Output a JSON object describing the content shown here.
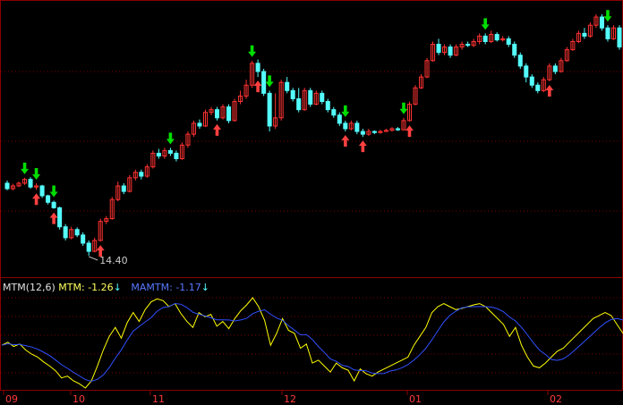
{
  "indicator": {
    "name": "MTM(12,6)",
    "mtm_label": "MTM:",
    "mtm_value": "-1.26",
    "mtm_arrow": "↓",
    "mamtm_label": "MAMTM:",
    "mamtm_value": "-1.17",
    "mamtm_arrow": "↓"
  },
  "colors": {
    "background": "#000000",
    "frame": "#8b0000",
    "up": "#ff3232",
    "down": "#54fcfc",
    "buy_arrow": "#ff4040",
    "sell_arrow": "#00dd00",
    "mtm_line": "#ffff00",
    "mamtm_line": "#3050ff",
    "axis_text": "#ff3a3a",
    "label_text": "#dddddd"
  },
  "chart_data": {
    "type": "candlestick",
    "x_ticks": [
      "09",
      "10",
      "11",
      "12",
      "01",
      "02"
    ],
    "low_label": "14.40",
    "candles": [
      [
        37.5,
        36.5,
        38.0,
        36.2
      ],
      [
        36.5,
        37.0,
        37.4,
        36.2
      ],
      [
        37.0,
        37.5,
        37.8,
        36.8
      ],
      [
        37.5,
        38.2,
        38.5,
        37.2
      ],
      [
        38.2,
        36.8,
        38.6,
        36.5
      ],
      [
        36.8,
        37.0,
        37.5,
        36.3
      ],
      [
        37.0,
        35.2,
        37.2,
        34.8
      ],
      [
        35.2,
        34.0,
        35.4,
        33.6
      ],
      [
        34.0,
        33.0,
        34.3,
        32.8
      ],
      [
        33.0,
        29.5,
        33.2,
        29.0
      ],
      [
        29.5,
        27.5,
        30.0,
        27.0
      ],
      [
        27.5,
        29.0,
        29.5,
        27.2
      ],
      [
        29.0,
        28.0,
        29.4,
        27.6
      ],
      [
        28.0,
        26.5,
        28.5,
        26.0
      ],
      [
        26.5,
        25.0,
        27.0,
        24.2
      ],
      [
        25.0,
        27.0,
        27.5,
        24.8
      ],
      [
        27.0,
        30.5,
        31.0,
        26.8
      ],
      [
        30.5,
        31.0,
        31.5,
        30.0
      ],
      [
        31.0,
        34.5,
        35.0,
        30.8
      ],
      [
        34.5,
        37.0,
        37.8,
        34.2
      ],
      [
        37.0,
        36.0,
        37.5,
        35.5
      ],
      [
        36.0,
        38.5,
        39.0,
        35.8
      ],
      [
        38.5,
        39.5,
        40.0,
        38.0
      ],
      [
        39.5,
        38.8,
        40.0,
        38.2
      ],
      [
        38.8,
        40.5,
        41.0,
        38.5
      ],
      [
        40.5,
        43.0,
        43.5,
        40.2
      ],
      [
        43.0,
        42.5,
        43.8,
        42.0
      ],
      [
        42.5,
        43.5,
        44.0,
        42.0
      ],
      [
        43.5,
        43.0,
        44.0,
        42.5
      ],
      [
        43.0,
        42.0,
        43.5,
        41.5
      ],
      [
        42.0,
        44.5,
        45.0,
        41.8
      ],
      [
        44.5,
        46.5,
        47.0,
        44.0
      ],
      [
        46.5,
        48.5,
        49.0,
        46.0
      ],
      [
        48.5,
        48.0,
        49.2,
        47.5
      ],
      [
        48.0,
        50.5,
        51.0,
        47.8
      ],
      [
        50.5,
        51.0,
        51.5,
        50.0
      ],
      [
        51.0,
        49.5,
        51.5,
        49.0
      ],
      [
        49.5,
        51.5,
        52.0,
        49.2
      ],
      [
        51.5,
        49.0,
        52.0,
        48.5
      ],
      [
        49.0,
        52.5,
        53.0,
        48.8
      ],
      [
        52.5,
        53.5,
        54.5,
        52.0
      ],
      [
        53.5,
        55.5,
        56.5,
        53.0
      ],
      [
        55.5,
        59.5,
        60.0,
        55.0
      ],
      [
        59.5,
        58.0,
        60.2,
        57.0
      ],
      [
        58.0,
        54.0,
        58.5,
        53.5
      ],
      [
        54.0,
        48.0,
        54.5,
        47.0
      ],
      [
        48.0,
        49.5,
        54.0,
        47.5
      ],
      [
        49.5,
        56.0,
        56.5,
        49.0
      ],
      [
        56.0,
        54.5,
        57.0,
        54.0
      ],
      [
        54.5,
        53.0,
        55.0,
        52.5
      ],
      [
        53.0,
        51.0,
        55.0,
        50.5
      ],
      [
        51.0,
        54.5,
        55.0,
        50.8
      ],
      [
        54.5,
        52.0,
        55.0,
        51.5
      ],
      [
        52.0,
        54.0,
        54.5,
        51.8
      ],
      [
        54.0,
        52.5,
        54.5,
        52.0
      ],
      [
        52.5,
        51.0,
        53.0,
        50.5
      ],
      [
        51.0,
        50.0,
        51.5,
        49.5
      ],
      [
        50.0,
        48.5,
        50.5,
        48.0
      ],
      [
        48.5,
        47.5,
        49.0,
        47.0
      ],
      [
        47.5,
        48.5,
        49.0,
        47.2
      ],
      [
        48.5,
        47.0,
        49.0,
        46.5
      ],
      [
        47.0,
        46.5,
        47.5,
        46.0
      ],
      [
        46.5,
        47.0,
        47.5,
        46.2
      ],
      [
        47.0,
        46.8,
        47.2,
        46.5
      ],
      [
        46.8,
        47.0,
        47.3,
        46.6
      ],
      [
        47.0,
        47.2,
        47.5,
        46.9
      ],
      [
        47.2,
        47.5,
        47.8,
        47.0
      ],
      [
        47.5,
        47.3,
        47.8,
        47.1
      ],
      [
        47.3,
        49.0,
        49.5,
        47.2
      ],
      [
        49.0,
        52.0,
        52.5,
        48.8
      ],
      [
        52.0,
        55.0,
        55.5,
        51.8
      ],
      [
        55.0,
        57.0,
        57.5,
        54.8
      ],
      [
        57.0,
        60.0,
        60.5,
        56.8
      ],
      [
        60.0,
        63.0,
        63.5,
        59.8
      ],
      [
        63.0,
        61.5,
        64.0,
        61.0
      ],
      [
        61.5,
        62.5,
        63.0,
        61.0
      ],
      [
        62.5,
        61.0,
        63.0,
        60.5
      ],
      [
        61.0,
        62.5,
        63.0,
        60.8
      ],
      [
        62.5,
        63.0,
        63.5,
        62.0
      ],
      [
        63.0,
        62.8,
        63.5,
        62.5
      ],
      [
        62.8,
        63.5,
        64.0,
        62.5
      ],
      [
        63.5,
        64.5,
        65.0,
        63.0
      ],
      [
        64.5,
        63.5,
        65.0,
        63.0
      ],
      [
        63.5,
        64.8,
        65.5,
        63.2
      ],
      [
        64.8,
        63.8,
        65.2,
        63.5
      ],
      [
        63.8,
        64.0,
        64.5,
        63.5
      ],
      [
        64.0,
        63.0,
        64.5,
        62.5
      ],
      [
        63.0,
        61.0,
        63.5,
        60.5
      ],
      [
        61.0,
        59.0,
        61.5,
        58.5
      ],
      [
        59.0,
        57.0,
        59.5,
        56.0
      ],
      [
        57.0,
        55.5,
        57.5,
        55.0
      ],
      [
        55.5,
        54.5,
        56.0,
        54.0
      ],
      [
        54.5,
        56.5,
        57.0,
        54.2
      ],
      [
        56.5,
        59.0,
        59.5,
        56.2
      ],
      [
        59.0,
        58.0,
        59.5,
        57.5
      ],
      [
        58.0,
        60.0,
        60.5,
        57.8
      ],
      [
        60.0,
        62.0,
        62.5,
        59.8
      ],
      [
        62.0,
        63.5,
        64.0,
        61.8
      ],
      [
        63.5,
        65.0,
        65.5,
        63.2
      ],
      [
        65.0,
        64.5,
        66.0,
        64.0
      ],
      [
        64.5,
        66.5,
        67.0,
        64.2
      ],
      [
        66.5,
        68.0,
        68.5,
        66.0
      ],
      [
        68.0,
        66.0,
        68.5,
        65.5
      ],
      [
        66.0,
        64.0,
        66.5,
        63.5
      ],
      [
        64.0,
        66.0,
        66.5,
        63.8
      ],
      [
        66.0,
        62.5,
        66.5,
        62.0
      ]
    ],
    "buy_signals": [
      5,
      8,
      16,
      36,
      43,
      58,
      61,
      69,
      93
    ],
    "sell_signals": [
      3,
      5,
      8,
      28,
      42,
      45,
      58,
      68,
      82,
      103
    ],
    "mtm": [
      1.0,
      1.5,
      0.8,
      1.2,
      0.2,
      -0.5,
      -1.0,
      -1.8,
      -2.5,
      -3.3,
      -4.5,
      -4.2,
      -5.0,
      -5.5,
      -6.2,
      -5.0,
      -2.5,
      0.2,
      2.5,
      4.0,
      2.2,
      4.8,
      6.5,
      5.0,
      7.0,
      8.3,
      8.8,
      8.5,
      7.5,
      8.0,
      6.3,
      5.0,
      4.0,
      6.5,
      5.8,
      6.2,
      4.2,
      5.0,
      3.8,
      5.5,
      6.8,
      7.8,
      9.0,
      7.5,
      5.2,
      1.0,
      3.0,
      5.5,
      3.5,
      3.0,
      0.5,
      1.2,
      -2.0,
      -1.5,
      -2.5,
      -3.5,
      -2.0,
      -2.8,
      -3.2,
      -5.0,
      -3.0,
      -3.8,
      -4.2,
      -3.5,
      -3.0,
      -2.5,
      -2.0,
      -1.5,
      -1.0,
      1.0,
      2.5,
      4.0,
      6.5,
      7.5,
      8.0,
      7.5,
      7.0,
      7.2,
      7.5,
      7.8,
      8.0,
      7.5,
      6.5,
      5.5,
      4.5,
      2.5,
      4.0,
      1.0,
      -1.0,
      -2.5,
      -2.8,
      -2.0,
      -1.0,
      0.0,
      0.5,
      1.5,
      2.5,
      3.5,
      4.5,
      5.5,
      6.0,
      6.5,
      6.0,
      4.5,
      3.0
    ]
  }
}
